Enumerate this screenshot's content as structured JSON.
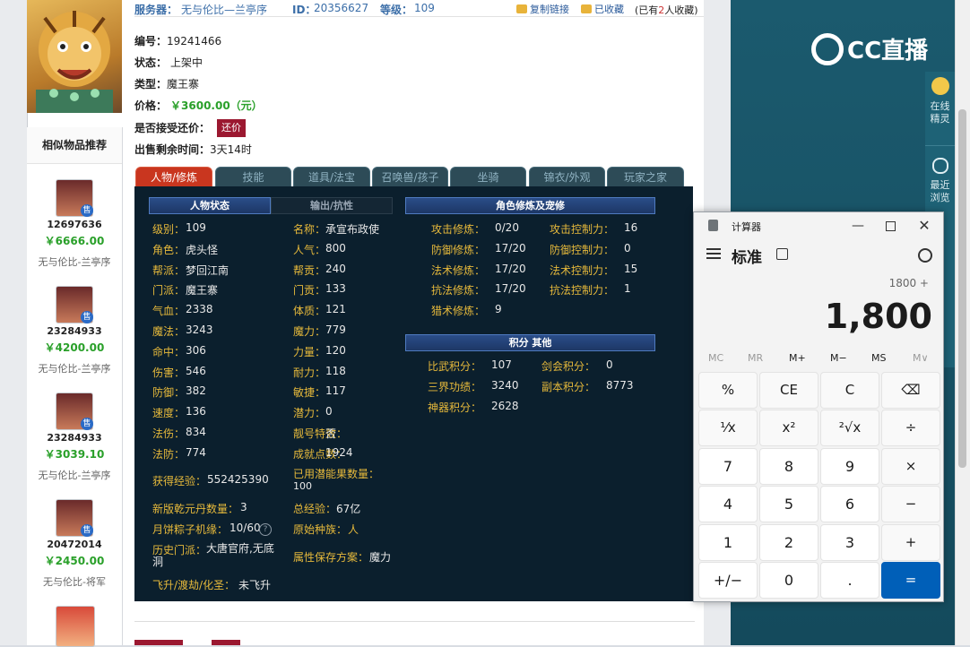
{
  "header": {
    "server_label": "服务器：",
    "server_value": "无与伦比—兰亭序",
    "id_label": "ID：",
    "id_value": "20356627",
    "level_label": "等级：",
    "level_value": "109",
    "copy_link": "复制链接",
    "favorited": "已收藏",
    "fav_count_prefix": "(已有",
    "fav_count": "2",
    "fav_count_suffix": "人收藏)"
  },
  "item": {
    "number_label": "编号：",
    "number_value": "19241466",
    "status_label": "状态：",
    "status_value": "上架中",
    "type_label": "类型：",
    "type_value": "魔王寨",
    "price_label": "价格：",
    "price_value": "￥3600.00（元）",
    "bargain_label": "是否接受还价：",
    "bargain_button": "还价",
    "remain_label": "出售剩余时间：",
    "remain_value": "3天14时"
  },
  "sidebar": {
    "title": "相似物品推荐",
    "items": [
      {
        "id": "12697636",
        "price": "￥6666.00",
        "server": "无与伦比-兰亭序",
        "badge": "售"
      },
      {
        "id": "23284933",
        "price": "￥4200.00",
        "server": "无与伦比-兰亭序",
        "badge": "售"
      },
      {
        "id": "23284933",
        "price": "￥3039.10",
        "server": "无与伦比-兰亭序",
        "badge": "售"
      },
      {
        "id": "20472014",
        "price": "￥2450.00",
        "server": "无与伦比-将军",
        "badge": "售"
      }
    ]
  },
  "tabs": [
    "人物/修炼",
    "技能",
    "道具/法宝",
    "召唤兽/孩子",
    "坐骑",
    "锦衣/外观",
    "玩家之家"
  ],
  "panel": {
    "sec_char": "人物状态",
    "sec_out": "输出/抗性",
    "sec_train": "角色修炼及宠修",
    "sec_points": "积分",
    "sec_other": "其他",
    "left": [
      {
        "k": "级别：",
        "v": "109"
      },
      {
        "k": "角色：",
        "v": "虎头怪"
      },
      {
        "k": "帮派：",
        "v": "梦回江南"
      },
      {
        "k": "门派：",
        "v": "魔王寨"
      },
      {
        "k": "气血：",
        "v": "2338"
      },
      {
        "k": "魔法：",
        "v": "3243"
      },
      {
        "k": "命中：",
        "v": "306"
      },
      {
        "k": "伤害：",
        "v": "546"
      },
      {
        "k": "防御：",
        "v": "382"
      },
      {
        "k": "速度：",
        "v": "136"
      },
      {
        "k": "法伤：",
        "v": "834"
      },
      {
        "k": "法防：",
        "v": "774"
      }
    ],
    "mid": [
      {
        "k": "名称：",
        "v": "承宣布政使"
      },
      {
        "k": "人气：",
        "v": "800"
      },
      {
        "k": "帮贡：",
        "v": "240"
      },
      {
        "k": "门贡：",
        "v": "133"
      },
      {
        "k": "体质：",
        "v": "121"
      },
      {
        "k": "魔力：",
        "v": "779"
      },
      {
        "k": "力量：",
        "v": "120"
      },
      {
        "k": "耐力：",
        "v": "118"
      },
      {
        "k": "敏捷：",
        "v": "117"
      },
      {
        "k": "潜力：",
        "v": "0"
      },
      {
        "k": "靓号特效：",
        "v": "否"
      },
      {
        "k": "成就点数：",
        "v": "1924"
      }
    ],
    "exp_label": "获得经验：",
    "exp_value": "552425390",
    "used_potential_label": "已用潜能果数量：",
    "used_potential_value": "100",
    "qianyuan_label": "新版乾元丹数量：",
    "qianyuan_value": "3",
    "total_exp_label": "总经验：",
    "total_exp_value": "67亿",
    "mooncake_label": "月饼粽子机缘：",
    "mooncake_value": "10/60",
    "race_label": "原始种族：",
    "race_value": "人",
    "hist_label": "历史门派：",
    "hist_value": "大唐官府,无底洞",
    "attr_label": "属性保存方案：",
    "attr_value": "魔力",
    "ascend_label": "飞升/渡劫/化圣：",
    "ascend_value": "未飞升",
    "train_left": [
      {
        "k": "攻击修炼：",
        "v": "0/20"
      },
      {
        "k": "防御修炼：",
        "v": "17/20"
      },
      {
        "k": "法术修炼：",
        "v": "17/20"
      },
      {
        "k": "抗法修炼：",
        "v": "17/20"
      },
      {
        "k": "猎术修炼：",
        "v": "9"
      }
    ],
    "train_right": [
      {
        "k": "攻击控制力：",
        "v": "16"
      },
      {
        "k": "防御控制力：",
        "v": "0"
      },
      {
        "k": "法术控制力：",
        "v": "15"
      },
      {
        "k": "抗法控制力：",
        "v": "1"
      }
    ],
    "points_left": [
      {
        "k": "比武积分：",
        "v": "107"
      },
      {
        "k": "三界功绩：",
        "v": "3240"
      },
      {
        "k": "神器积分：",
        "v": "2628"
      }
    ],
    "points_right": [
      {
        "k": "剑会积分：",
        "v": "0"
      },
      {
        "k": "副本积分：",
        "v": "8773"
      }
    ]
  },
  "calculator": {
    "title": "计算器",
    "mode": "标准",
    "expression": "1800 +",
    "display": "1,800",
    "memory": [
      "MC",
      "MR",
      "M+",
      "M−",
      "MS",
      "M∨"
    ],
    "buttons": [
      [
        "%",
        "CE",
        "C",
        "⌫"
      ],
      [
        "¹⁄x",
        "x²",
        "²√x",
        "÷"
      ],
      [
        "7",
        "8",
        "9",
        "×"
      ],
      [
        "4",
        "5",
        "6",
        "−"
      ],
      [
        "1",
        "2",
        "3",
        "+"
      ],
      [
        "+/−",
        "0",
        ".",
        "="
      ]
    ]
  },
  "rightapp": {
    "logo": "CC直播",
    "side_items": [
      {
        "label": "在线精灵"
      },
      {
        "label": "最近浏览"
      }
    ]
  }
}
